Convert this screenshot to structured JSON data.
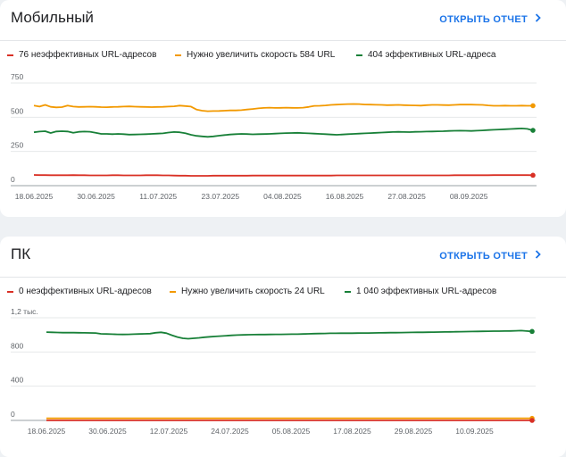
{
  "colors": {
    "invalid": "#d93025",
    "improve": "#f29900",
    "good": "#188038",
    "link": "#1a73e8"
  },
  "cards": [
    {
      "title": "Мобильный",
      "open_report": "ОТКРЫТЬ ОТЧЕТ",
      "legend": [
        "76 неэффективных URL-адресов",
        "Нужно увеличить скорость 584 URL",
        "404 эффективных URL-адреса"
      ]
    },
    {
      "title": "ПК",
      "open_report": "ОТКРЫТЬ ОТЧЕТ",
      "legend": [
        "0 неэффективных URL-адресов",
        "Нужно увеличить скорость 24 URL",
        "1 040 эффективных URL-адресов"
      ]
    }
  ],
  "chart_data": [
    {
      "type": "line",
      "title": "Мобильный",
      "ylim": [
        0,
        750
      ],
      "y_ticks": [
        "0",
        "250",
        "500",
        "750"
      ],
      "x_tick_labels": [
        "18.06.2025",
        "30.06.2025",
        "11.07.2025",
        "23.07.2025",
        "04.08.2025",
        "16.08.2025",
        "27.08.2025",
        "08.09.2025"
      ],
      "grid": true,
      "legend_position": "top",
      "x_start": "18.06.2025",
      "x_end": "15.09.2025",
      "series": [
        {
          "name": "Нужно увеличить скорость 584 URL",
          "color": "#f29900",
          "values": [
            585,
            578,
            590,
            576,
            572,
            574,
            585,
            578,
            575,
            576,
            577,
            576,
            574,
            573,
            575,
            576,
            578,
            579,
            577,
            576,
            575,
            574,
            575,
            576,
            578,
            580,
            585,
            582,
            578,
            556,
            548,
            544,
            545,
            546,
            548,
            550,
            550,
            552,
            556,
            560,
            565,
            568,
            570,
            568,
            569,
            570,
            569,
            568,
            570,
            575,
            583,
            584,
            586,
            590,
            592,
            594,
            596,
            597,
            596,
            593,
            592,
            591,
            590,
            588,
            589,
            590,
            588,
            587,
            586,
            585,
            588,
            590,
            590,
            589,
            588,
            590,
            592,
            593,
            592,
            591,
            590,
            586,
            584,
            584,
            585,
            584,
            584,
            585,
            584,
            584
          ]
        },
        {
          "name": "404 эффективных URL-адреса",
          "color": "#188038",
          "values": [
            390,
            395,
            398,
            385,
            396,
            398,
            396,
            386,
            393,
            395,
            394,
            387,
            378,
            378,
            376,
            378,
            376,
            373,
            374,
            375,
            376,
            378,
            380,
            382,
            388,
            392,
            390,
            383,
            372,
            364,
            360,
            357,
            360,
            365,
            370,
            374,
            376,
            378,
            377,
            375,
            376,
            377,
            378,
            380,
            382,
            384,
            385,
            386,
            384,
            382,
            380,
            378,
            376,
            374,
            372,
            374,
            376,
            378,
            380,
            382,
            384,
            386,
            388,
            390,
            392,
            393,
            392,
            391,
            393,
            394,
            395,
            396,
            397,
            398,
            400,
            401,
            402,
            401,
            400,
            402,
            404,
            406,
            408,
            410,
            412,
            414,
            416,
            418,
            415,
            404
          ]
        },
        {
          "name": "76 неэффективных URL-адресов",
          "color": "#d93025",
          "values": [
            78,
            77,
            77,
            76,
            76,
            76,
            76,
            77,
            76,
            76,
            75,
            75,
            75,
            75,
            76,
            76,
            75,
            75,
            75,
            75,
            76,
            76,
            76,
            75,
            75,
            74,
            73,
            73,
            72,
            72,
            72,
            72,
            73,
            73,
            73,
            73,
            73,
            73,
            73,
            74,
            74,
            74,
            74,
            74,
            74,
            74,
            74,
            74,
            74,
            74,
            74,
            74,
            74,
            74,
            75,
            75,
            75,
            75,
            75,
            75,
            75,
            75,
            75,
            75,
            75,
            75,
            75,
            75,
            75,
            75,
            75,
            75,
            75,
            75,
            75,
            76,
            76,
            76,
            76,
            76,
            76,
            76,
            77,
            77,
            77,
            77,
            77,
            77,
            77,
            76
          ]
        }
      ]
    },
    {
      "type": "line",
      "title": "ПК",
      "ylim": [
        0,
        1200
      ],
      "y_ticks": [
        "0",
        "400",
        "800",
        "1,2 тыс."
      ],
      "x_tick_labels": [
        "18.06.2025",
        "30.06.2025",
        "12.07.2025",
        "24.07.2025",
        "05.08.2025",
        "17.08.2025",
        "29.08.2025",
        "10.09.2025"
      ],
      "grid": true,
      "legend_position": "top",
      "x_start": "18.06.2025",
      "x_end": "15.09.2025",
      "series": [
        {
          "name": "1 040 эффективных URL-адресов",
          "color": "#188038",
          "values": [
            1032,
            1030,
            1028,
            1026,
            1027,
            1026,
            1025,
            1024,
            1023,
            1022,
            1012,
            1010,
            1008,
            1006,
            1005,
            1006,
            1008,
            1010,
            1012,
            1014,
            1025,
            1030,
            1020,
            995,
            975,
            960,
            955,
            960,
            965,
            972,
            978,
            982,
            986,
            990,
            994,
            998,
            1000,
            1002,
            1003,
            1004,
            1004,
            1005,
            1006,
            1006,
            1007,
            1008,
            1008,
            1010,
            1012,
            1014,
            1015,
            1016,
            1018,
            1018,
            1019,
            1020,
            1020,
            1021,
            1022,
            1022,
            1023,
            1024,
            1025,
            1026,
            1026,
            1027,
            1028,
            1029,
            1030,
            1030,
            1031,
            1032,
            1033,
            1034,
            1035,
            1036,
            1037,
            1038,
            1039,
            1040,
            1041,
            1042,
            1043,
            1044,
            1045,
            1046,
            1048,
            1050,
            1045,
            1040
          ]
        },
        {
          "name": "Нужно увеличить скорость 24 URL",
          "color": "#f29900",
          "values": [
            24,
            24,
            24,
            24,
            24,
            24,
            24,
            24,
            24,
            24,
            24,
            24,
            24,
            24,
            24,
            24,
            24,
            24,
            24,
            24,
            24,
            24,
            24,
            24,
            24,
            24,
            24,
            24,
            24,
            24,
            24,
            24,
            24,
            24,
            24,
            24,
            24,
            24,
            24,
            24,
            24,
            24,
            24,
            24,
            24,
            24,
            24,
            24,
            24,
            24,
            24,
            24,
            24,
            24,
            24,
            24,
            24,
            24,
            24,
            24,
            24,
            24,
            24,
            24,
            24,
            24,
            24,
            24,
            24,
            24,
            24,
            24,
            24,
            24,
            24,
            24,
            24,
            24,
            24,
            24,
            24,
            24,
            24,
            24,
            24,
            24,
            24,
            24,
            24,
            24
          ]
        },
        {
          "name": "0 неэффективных URL-адресов",
          "color": "#d93025",
          "values": [
            0,
            0,
            0,
            0,
            0,
            0,
            0,
            0,
            0,
            0,
            0,
            0,
            0,
            0,
            0,
            0,
            0,
            0,
            0,
            0,
            0,
            0,
            0,
            0,
            0,
            0,
            0,
            0,
            0,
            0,
            0,
            0,
            0,
            0,
            0,
            0,
            0,
            0,
            0,
            0,
            0,
            0,
            0,
            0,
            0,
            0,
            0,
            0,
            0,
            0,
            0,
            0,
            0,
            0,
            0,
            0,
            0,
            0,
            0,
            0,
            0,
            0,
            0,
            0,
            0,
            0,
            0,
            0,
            0,
            0,
            0,
            0,
            0,
            0,
            0,
            0,
            0,
            0,
            0,
            0,
            0,
            0,
            0,
            0,
            0,
            0,
            0,
            0,
            0,
            0
          ]
        }
      ]
    }
  ]
}
